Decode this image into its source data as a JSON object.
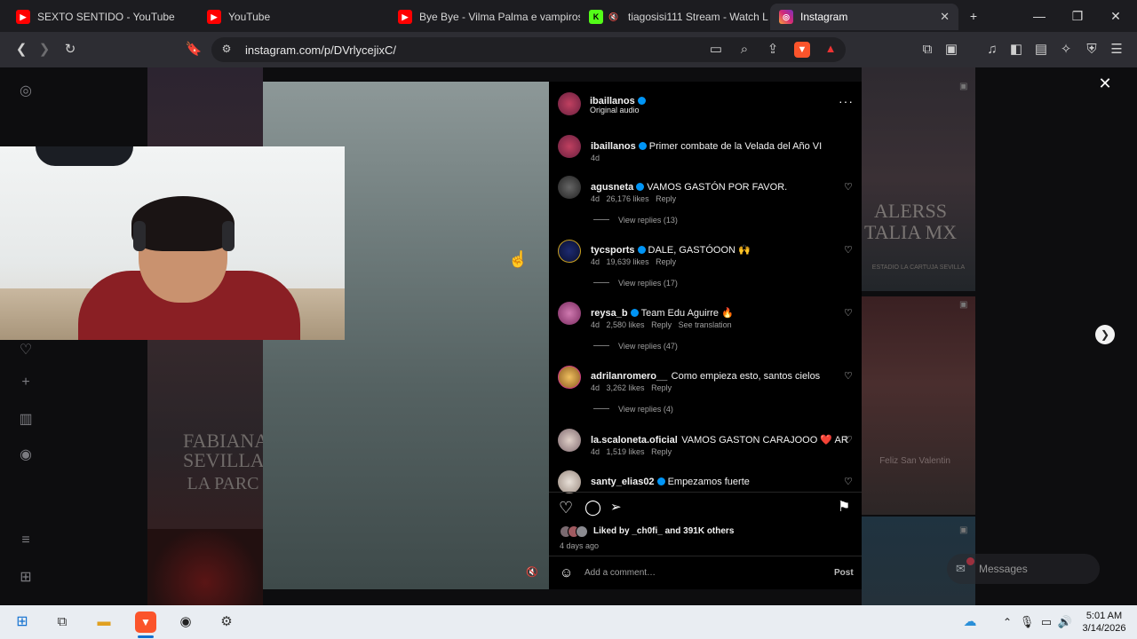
{
  "tabs": [
    {
      "title": "SEXTO SENTIDO - YouTube",
      "icon": "youtube-icon"
    },
    {
      "title": "YouTube",
      "icon": "youtube-icon"
    },
    {
      "title": "Bye Bye - Vilma Palma e vampiros",
      "icon": "youtube-icon"
    },
    {
      "title": "tiagosisi111 Stream - Watch L",
      "icon": "kick-icon"
    },
    {
      "title": "Instagram",
      "icon": "instagram-icon"
    }
  ],
  "address_bar": {
    "url": "instagram.com/p/DVrlycejixC/"
  },
  "post": {
    "author": "ibaillanos",
    "audio": "Original audio",
    "caption_user": "ibaillanos",
    "caption_text": "Primer combate de la Velada del Año VI",
    "caption_age": "4d",
    "likes_text": "Liked by _ch0fi_ and 391K others",
    "age": "4 days ago",
    "comment_placeholder": "Add a comment…",
    "post_label": "Post"
  },
  "comments": [
    {
      "user": "agusneta",
      "verified": true,
      "text": "VAMOS GASTÓN POR FAVOR.",
      "age": "4d",
      "likes": "26,176 likes",
      "reply": "Reply",
      "view_replies": "View replies (13)"
    },
    {
      "user": "tycsports",
      "verified": true,
      "text": "DALE, GASTÓOON 🙌",
      "age": "4d",
      "likes": "19,639 likes",
      "reply": "Reply",
      "view_replies": "View replies (17)"
    },
    {
      "user": "reysa_b",
      "verified": true,
      "text": "Team Edu Aguirre 🔥",
      "age": "4d",
      "likes": "2,580 likes",
      "reply": "Reply",
      "extra": "See translation",
      "view_replies": "View replies (47)"
    },
    {
      "user": "adrilanromero__",
      "verified": false,
      "text": "Como empieza esto, santos cielos",
      "age": "4d",
      "likes": "3,262 likes",
      "reply": "Reply",
      "view_replies": "View replies (4)"
    },
    {
      "user": "la.scaloneta.oficial",
      "verified": false,
      "text": "VAMOS GASTON CARAJOOO ❤️ AR",
      "age": "4d",
      "likes": "1,519 likes",
      "reply": "Reply"
    },
    {
      "user": "santy_elias02",
      "verified": true,
      "text": "Empezamos fuerte"
    }
  ],
  "messages_label": "Messages",
  "background_text": {
    "left_poster": "FABIANA SEVILLANA",
    "left_poster_sub": "LA PARC",
    "right_poster": "ALERSS TALIA MX",
    "right_poster_sub": "ESTADIO LA CARTUJA SEVILLA",
    "right_poster2": "Feliz San Valentin"
  },
  "clock": {
    "time": "5:01 AM",
    "date": "3/14/2026"
  },
  "colors": {
    "accent_verified": "#0095f6",
    "brave": "#fb542b",
    "youtube": "#ff0000"
  }
}
